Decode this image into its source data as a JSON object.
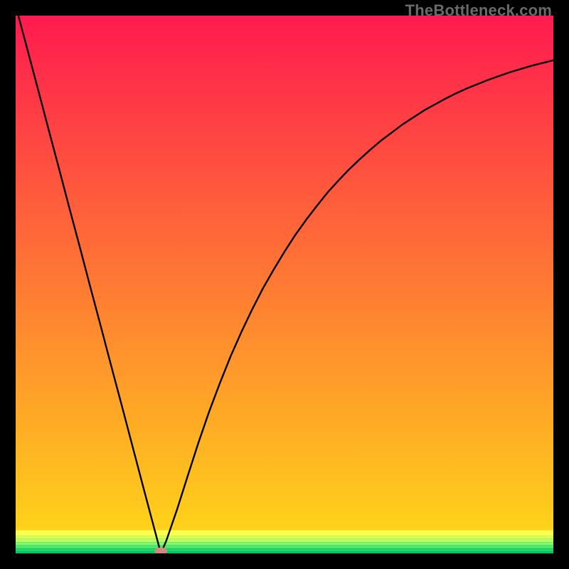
{
  "watermark": "TheBottleneck.com",
  "chart_data": {
    "type": "line",
    "title": "",
    "xlabel": "",
    "ylabel": "",
    "xlim": [
      0,
      100
    ],
    "ylim": [
      0,
      100
    ],
    "grid": false,
    "legend": false,
    "minimum_point": {
      "x": 27,
      "y": 0
    },
    "series": [
      {
        "name": "bottleneck-curve",
        "color": "#000000",
        "points": [
          {
            "x": 0.5,
            "y": 100
          },
          {
            "x": 2,
            "y": 94.4
          },
          {
            "x": 4,
            "y": 86.9
          },
          {
            "x": 6,
            "y": 79.3
          },
          {
            "x": 8,
            "y": 71.8
          },
          {
            "x": 10,
            "y": 64.2
          },
          {
            "x": 12,
            "y": 56.7
          },
          {
            "x": 14,
            "y": 49.1
          },
          {
            "x": 16,
            "y": 41.6
          },
          {
            "x": 18,
            "y": 34.0
          },
          {
            "x": 20,
            "y": 26.5
          },
          {
            "x": 22,
            "y": 18.9
          },
          {
            "x": 24,
            "y": 11.3
          },
          {
            "x": 26,
            "y": 3.8
          },
          {
            "x": 27,
            "y": 0.0
          },
          {
            "x": 28,
            "y": 2.3
          },
          {
            "x": 30,
            "y": 8.1
          },
          {
            "x": 32,
            "y": 14.4
          },
          {
            "x": 34,
            "y": 20.6
          },
          {
            "x": 36,
            "y": 26.4
          },
          {
            "x": 38,
            "y": 31.7
          },
          {
            "x": 40,
            "y": 36.7
          },
          {
            "x": 42,
            "y": 41.2
          },
          {
            "x": 44,
            "y": 45.4
          },
          {
            "x": 46,
            "y": 49.3
          },
          {
            "x": 48,
            "y": 52.8
          },
          {
            "x": 50,
            "y": 56.1
          },
          {
            "x": 52,
            "y": 59.2
          },
          {
            "x": 54,
            "y": 62.0
          },
          {
            "x": 56,
            "y": 64.6
          },
          {
            "x": 58,
            "y": 67.1
          },
          {
            "x": 60,
            "y": 69.3
          },
          {
            "x": 62,
            "y": 71.4
          },
          {
            "x": 64,
            "y": 73.3
          },
          {
            "x": 66,
            "y": 75.1
          },
          {
            "x": 68,
            "y": 76.8
          },
          {
            "x": 70,
            "y": 78.3
          },
          {
            "x": 72,
            "y": 79.8
          },
          {
            "x": 74,
            "y": 81.1
          },
          {
            "x": 76,
            "y": 82.4
          },
          {
            "x": 78,
            "y": 83.5
          },
          {
            "x": 80,
            "y": 84.6
          },
          {
            "x": 82,
            "y": 85.6
          },
          {
            "x": 84,
            "y": 86.5
          },
          {
            "x": 86,
            "y": 87.3
          },
          {
            "x": 88,
            "y": 88.1
          },
          {
            "x": 90,
            "y": 88.8
          },
          {
            "x": 92,
            "y": 89.5
          },
          {
            "x": 94,
            "y": 90.1
          },
          {
            "x": 96,
            "y": 90.7
          },
          {
            "x": 98,
            "y": 91.2
          },
          {
            "x": 100,
            "y": 91.7
          }
        ]
      }
    ],
    "gradient_bands": [
      {
        "y0": 100,
        "y1": 4.3,
        "from": "#ff1a4f",
        "to": "#ffd21a"
      },
      {
        "y0": 4.3,
        "y1": 3.3,
        "color": "#fbff4f"
      },
      {
        "y0": 3.3,
        "y1": 2.7,
        "color": "#d9ff5a"
      },
      {
        "y0": 2.7,
        "y1": 2.1,
        "color": "#b4ff63"
      },
      {
        "y0": 2.1,
        "y1": 1.5,
        "color": "#84f96d"
      },
      {
        "y0": 1.5,
        "y1": 0.9,
        "color": "#4de86f"
      },
      {
        "y0": 0.9,
        "y1": 0.3,
        "color": "#1cd96b"
      },
      {
        "y0": 0.3,
        "y1": 0.0,
        "color": "#00c95f"
      }
    ],
    "marker": {
      "x": 27,
      "y": 0.4,
      "color": "#d48a7a",
      "rx": 1.2,
      "ry": 0.7
    }
  }
}
